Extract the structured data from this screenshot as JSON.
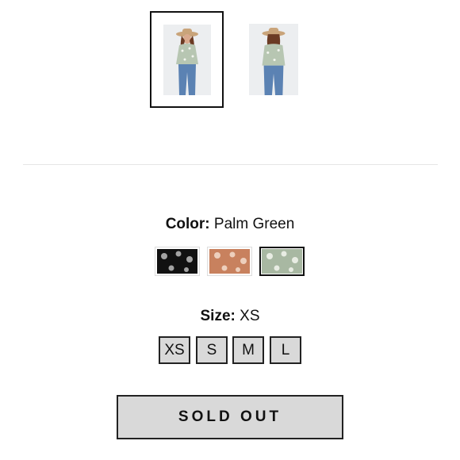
{
  "gallery": {
    "thumbnails": [
      {
        "alt": "",
        "selected": true
      },
      {
        "alt": "",
        "selected": false
      }
    ]
  },
  "color": {
    "label": "Color:",
    "value": "Palm Green",
    "swatches": [
      {
        "name": "black",
        "base": "#111111",
        "dot": "#bdbdbd",
        "selected": false
      },
      {
        "name": "rust",
        "base": "#c8815e",
        "dot": "#f1d7c6",
        "selected": false
      },
      {
        "name": "palm-green",
        "base": "#a8b8a2",
        "dot": "#eef2ea",
        "selected": true
      }
    ]
  },
  "size": {
    "label": "Size:",
    "value": "XS",
    "options": [
      "XS",
      "S",
      "M",
      "L"
    ]
  },
  "cta": {
    "label": "SOLD OUT"
  }
}
